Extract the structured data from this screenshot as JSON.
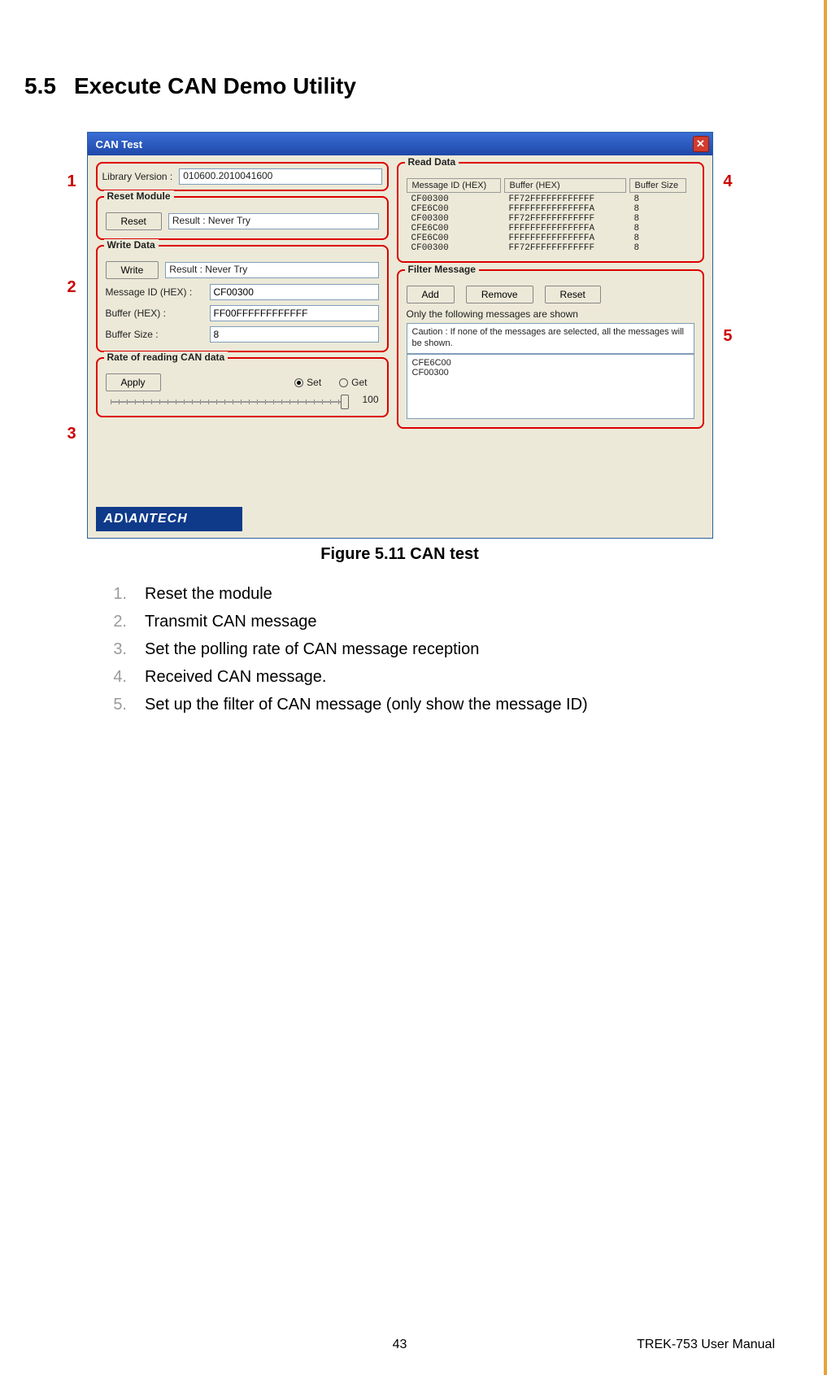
{
  "section": {
    "number": "5.5",
    "title": "Execute CAN Demo Utility"
  },
  "figure_caption": "Figure 5.11 CAN test",
  "callouts": {
    "c1": "1",
    "c2": "2",
    "c3": "3",
    "c4": "4",
    "c5": "5"
  },
  "win": {
    "title": "CAN Test",
    "lib_label": "Library Version :",
    "lib_value": "010600.2010041600",
    "reset": {
      "legend": "Reset Module",
      "button": "Reset",
      "result_label": "Result : Never Try"
    },
    "write": {
      "legend": "Write Data",
      "button": "Write",
      "result_label": "Result : Never Try",
      "msgid_label": "Message ID (HEX) :",
      "msgid_value": "CF00300",
      "buffer_label": "Buffer (HEX) :",
      "buffer_value": "FF00FFFFFFFFFFFF",
      "bufsize_label": "Buffer Size :",
      "bufsize_value": "8"
    },
    "rate": {
      "legend": "Rate of reading CAN data",
      "apply": "Apply",
      "set": "Set",
      "get": "Get",
      "value": "100"
    },
    "read": {
      "legend": "Read Data",
      "h1": "Message ID (HEX)",
      "h2": "Buffer (HEX)",
      "h3": "Buffer Size",
      "rows": [
        {
          "id": "CF00300",
          "buf": "FF72FFFFFFFFFFFF",
          "size": "8"
        },
        {
          "id": "CFE6C00",
          "buf": "FFFFFFFFFFFFFFFA",
          "size": "8"
        },
        {
          "id": "CF00300",
          "buf": "FF72FFFFFFFFFFFF",
          "size": "8"
        },
        {
          "id": "CFE6C00",
          "buf": "FFFFFFFFFFFFFFFA",
          "size": "8"
        },
        {
          "id": "CFE6C00",
          "buf": "FFFFFFFFFFFFFFFA",
          "size": "8"
        },
        {
          "id": "CF00300",
          "buf": "FF72FFFFFFFFFFFF",
          "size": "8"
        }
      ]
    },
    "filter": {
      "legend": "Filter Message",
      "add": "Add",
      "remove": "Remove",
      "reset": "Reset",
      "note": "Only the following messages are shown",
      "caution": "Caution : If none of the messages are selected, all the messages will be shown.",
      "items": [
        "CFE6C00",
        "CF00300"
      ]
    },
    "logo": "AD\\ANTECH"
  },
  "steps": [
    "Reset the module",
    "Transmit CAN message",
    "Set the polling rate of CAN message reception",
    "Received CAN message.",
    "Set up the filter of CAN message (only show the message ID)"
  ],
  "footer": {
    "page": "43",
    "manual": "TREK-753 User Manual"
  }
}
